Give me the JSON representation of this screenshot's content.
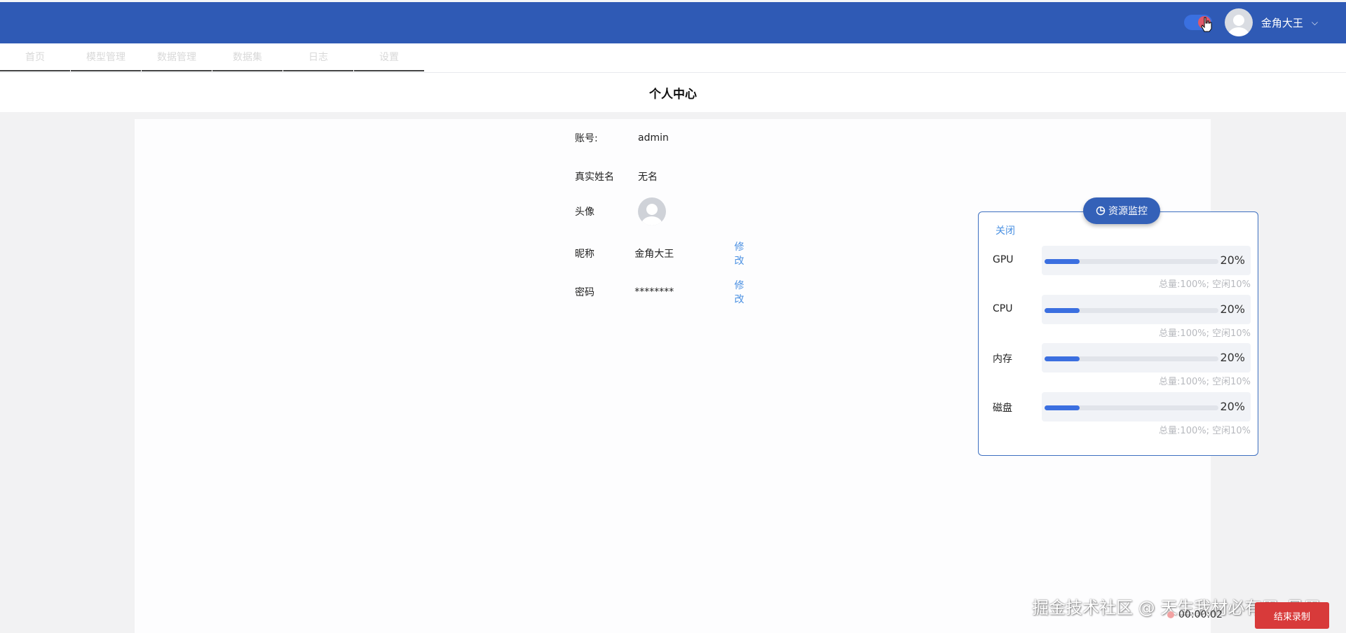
{
  "header": {
    "username": "金角大王",
    "chevron": "⌵",
    "colors": {
      "bar": "#2f5ab5"
    }
  },
  "nav": {
    "tabs": [
      "首页",
      "模型管理",
      "数据管理",
      "数据集",
      "日志",
      "设置"
    ]
  },
  "page": {
    "title": "个人中心"
  },
  "profile": {
    "account_label": "账号:",
    "account_value": "admin",
    "realname_label": "真实姓名",
    "realname_value": "无名",
    "avatar_label": "头像",
    "nickname_label": "昵称",
    "nickname_value": "金角大王",
    "nickname_action": "修改",
    "password_label": "密码",
    "password_value": "********",
    "password_action": "修改"
  },
  "monitor": {
    "title": "资源监控",
    "close_label": "关闭",
    "metrics": [
      {
        "name": "GPU",
        "percent": 20,
        "percent_label": "20%",
        "sub": "总量:100%; 空闲10%"
      },
      {
        "name": "CPU",
        "percent": 20,
        "percent_label": "20%",
        "sub": "总量:100%; 空闲10%"
      },
      {
        "name": "内存",
        "percent": 20,
        "percent_label": "20%",
        "sub": "总量:100%; 空闲10%"
      },
      {
        "name": "磁盘",
        "percent": 20,
        "percent_label": "20%",
        "sub": "总量:100%; 空闲10%"
      }
    ]
  },
  "overlay": {
    "watermark": "掘金技术社区 @ 天生我材必有用_吴用",
    "timer": "00:00:02",
    "record_button": "结束录制"
  }
}
